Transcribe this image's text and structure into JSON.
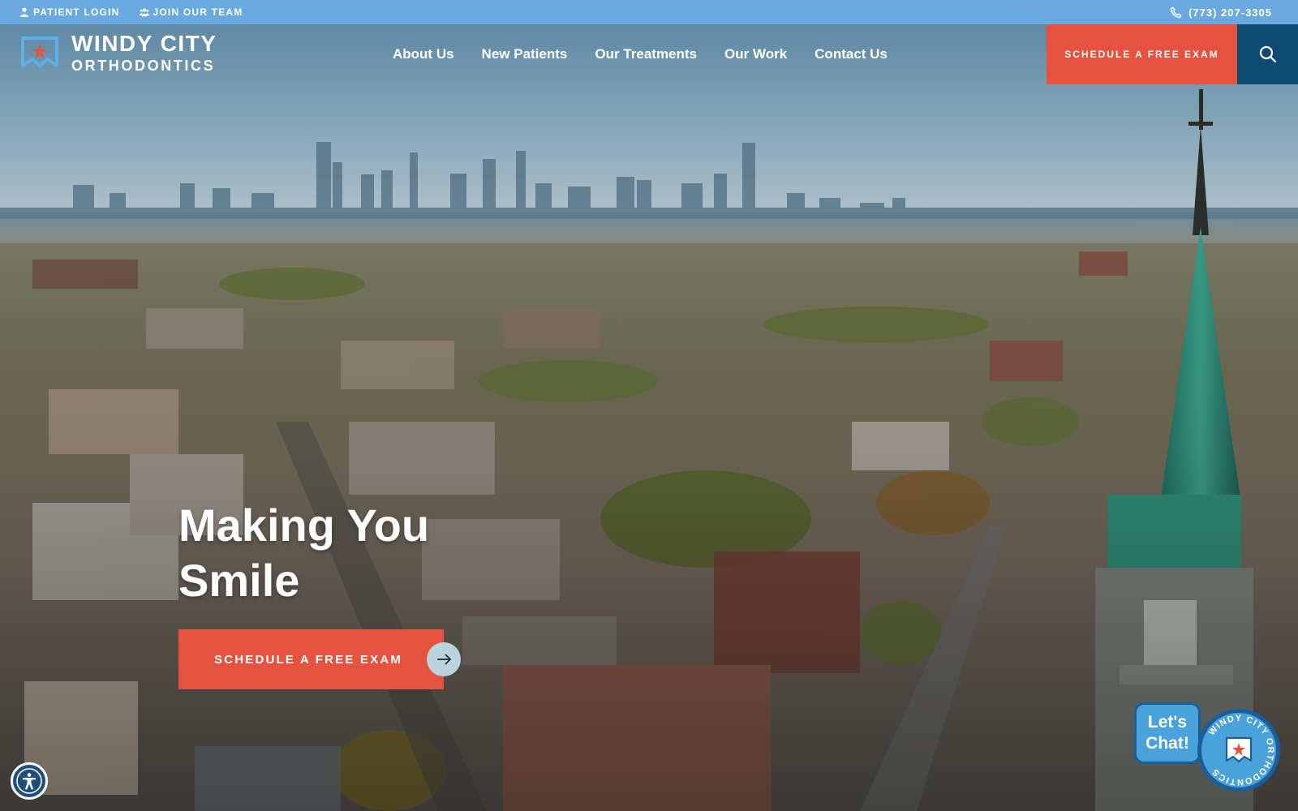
{
  "topbar": {
    "patient_login": "PATIENT LOGIN",
    "join_team": "JOIN OUR TEAM",
    "phone": "(773) 207-3305"
  },
  "logo": {
    "line1": "WINDY CITY",
    "line2": "ORTHODONTICS"
  },
  "nav": [
    {
      "label": "About Us"
    },
    {
      "label": "New Patients"
    },
    {
      "label": "Our Treatments"
    },
    {
      "label": "Our Work"
    },
    {
      "label": "Contact Us"
    }
  ],
  "header_cta": "SCHEDULE A FREE EXAM",
  "hero": {
    "headline_line1": "Making You",
    "headline_line2": "Smile",
    "cta": "SCHEDULE A FREE EXAM"
  },
  "chat": {
    "line1": "Let's",
    "line2": "Chat!",
    "badge_text": "WINDY CITY ORTHODONTICS"
  },
  "icons": {
    "patient_login": "user-icon",
    "join_team": "group-icon",
    "phone": "phone-icon",
    "search": "search-icon",
    "cta_arrow": "arrow-right-icon",
    "accessibility": "accessibility-icon"
  },
  "colors": {
    "topbar": "#6aa9df",
    "accent": "#e5523f",
    "search_bg": "#0f4a73",
    "chat_bubble": "#4aa2dc"
  }
}
